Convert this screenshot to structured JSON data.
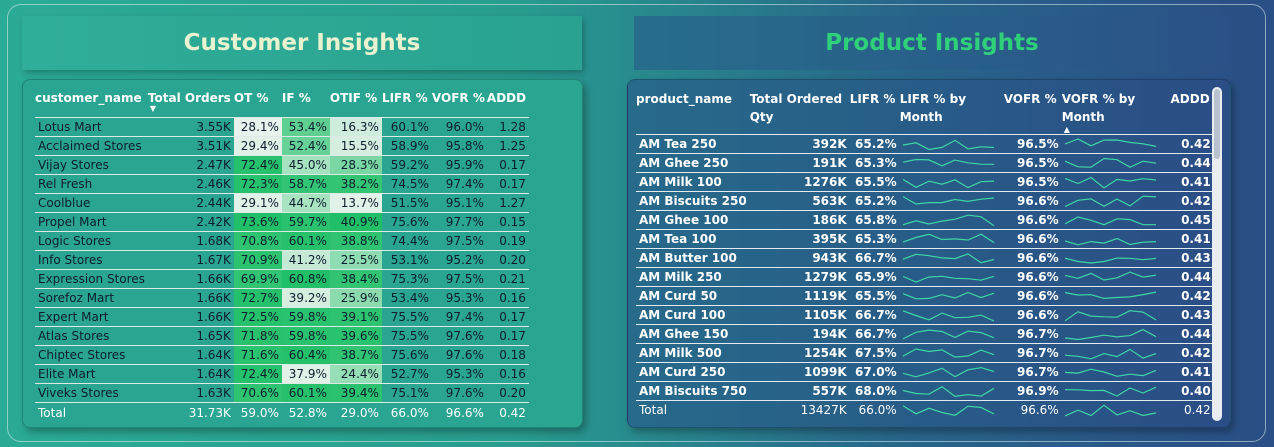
{
  "customer": {
    "title": "Customer Insights",
    "columns": [
      "customer_name",
      "Total Orders",
      "OT %",
      "IF %",
      "OTIF %",
      "LIFR %",
      "VOFR %",
      "ADDD"
    ],
    "rows": [
      [
        "Lotus Mart",
        "3.55K",
        "28.1%",
        "53.4%",
        "16.3%",
        "60.1%",
        "96.0%",
        "1.28"
      ],
      [
        "Acclaimed Stores",
        "3.51K",
        "29.4%",
        "52.4%",
        "15.5%",
        "58.9%",
        "95.8%",
        "1.25"
      ],
      [
        "Vijay Stores",
        "2.47K",
        "72.4%",
        "45.0%",
        "28.3%",
        "59.2%",
        "95.9%",
        "0.17"
      ],
      [
        "Rel Fresh",
        "2.46K",
        "72.3%",
        "58.7%",
        "38.2%",
        "74.5%",
        "97.4%",
        "0.17"
      ],
      [
        "Coolblue",
        "2.44K",
        "29.1%",
        "44.7%",
        "13.7%",
        "51.5%",
        "95.1%",
        "1.27"
      ],
      [
        "Propel Mart",
        "2.42K",
        "73.6%",
        "59.7%",
        "40.9%",
        "75.6%",
        "97.7%",
        "0.15"
      ],
      [
        "Logic Stores",
        "1.68K",
        "70.8%",
        "60.1%",
        "38.8%",
        "74.4%",
        "97.5%",
        "0.19"
      ],
      [
        "Info Stores",
        "1.67K",
        "70.9%",
        "41.2%",
        "25.5%",
        "53.1%",
        "95.2%",
        "0.20"
      ],
      [
        "Expression Stores",
        "1.66K",
        "69.9%",
        "60.8%",
        "38.4%",
        "75.3%",
        "97.5%",
        "0.21"
      ],
      [
        "Sorefoz Mart",
        "1.66K",
        "72.7%",
        "39.2%",
        "25.9%",
        "53.4%",
        "95.3%",
        "0.16"
      ],
      [
        "Expert Mart",
        "1.66K",
        "72.5%",
        "59.8%",
        "39.1%",
        "75.5%",
        "97.4%",
        "0.17"
      ],
      [
        "Atlas Stores",
        "1.65K",
        "71.8%",
        "59.8%",
        "39.6%",
        "75.5%",
        "97.6%",
        "0.17"
      ],
      [
        "Chiptec Stores",
        "1.64K",
        "71.6%",
        "60.4%",
        "38.7%",
        "75.6%",
        "97.6%",
        "0.18"
      ],
      [
        "Elite Mart",
        "1.64K",
        "72.4%",
        "37.9%",
        "24.4%",
        "52.7%",
        "95.3%",
        "0.16"
      ],
      [
        "Viveks Stores",
        "1.63K",
        "70.6%",
        "60.1%",
        "39.4%",
        "75.1%",
        "97.6%",
        "0.20"
      ]
    ],
    "total": [
      "Total",
      "31.73K",
      "59.0%",
      "52.8%",
      "29.0%",
      "66.0%",
      "96.6%",
      "0.42"
    ],
    "colors": {
      "high": "#1fbf67",
      "mid": "#7fd9a3",
      "low": "#e7f3ec",
      "lifr": "#2fae99"
    }
  },
  "product": {
    "title": "Product Insights",
    "columns": [
      "product_name",
      "Total Ordered Qty",
      "LIFR %",
      "LIFR % by Month",
      "VOFR %",
      "VOFR % by Month",
      "ADDD"
    ],
    "rows": [
      [
        "AM Tea 250",
        "392K",
        "65.2%",
        "96.5%",
        "0.42"
      ],
      [
        "AM Ghee 250",
        "191K",
        "65.3%",
        "96.5%",
        "0.44"
      ],
      [
        "AM Milk 100",
        "1276K",
        "65.5%",
        "96.5%",
        "0.41"
      ],
      [
        "AM Biscuits 250",
        "563K",
        "65.2%",
        "96.6%",
        "0.42"
      ],
      [
        "AM Ghee 100",
        "186K",
        "65.8%",
        "96.6%",
        "0.45"
      ],
      [
        "AM Tea 100",
        "395K",
        "65.3%",
        "96.6%",
        "0.41"
      ],
      [
        "AM Butter 100",
        "943K",
        "66.7%",
        "96.6%",
        "0.43"
      ],
      [
        "AM Milk 250",
        "1279K",
        "65.9%",
        "96.6%",
        "0.44"
      ],
      [
        "AM Curd 50",
        "1119K",
        "65.5%",
        "96.6%",
        "0.42"
      ],
      [
        "AM Curd 100",
        "1105K",
        "66.7%",
        "96.6%",
        "0.43"
      ],
      [
        "AM Ghee 150",
        "194K",
        "66.7%",
        "96.7%",
        "0.44"
      ],
      [
        "AM Milk 500",
        "1254K",
        "67.5%",
        "96.7%",
        "0.42"
      ],
      [
        "AM Curd 250",
        "1099K",
        "67.0%",
        "96.7%",
        "0.41"
      ],
      [
        "AM Biscuits 750",
        "557K",
        "68.0%",
        "96.9%",
        "0.40"
      ]
    ],
    "total": [
      "Total",
      "13427K",
      "66.0%",
      "96.6%",
      "0.42"
    ],
    "spark_color": "#3fd6a6"
  }
}
